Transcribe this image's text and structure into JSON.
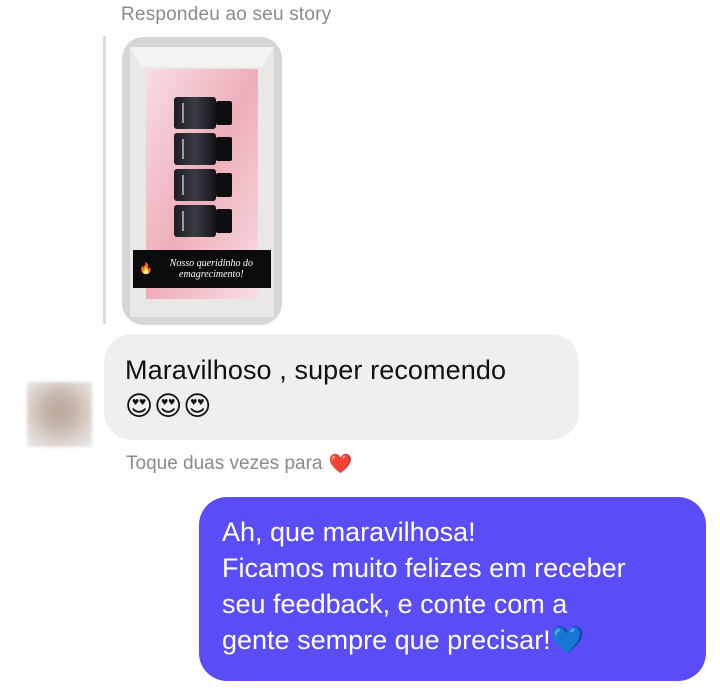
{
  "story_reply": {
    "label": "Respondeu ao seu story",
    "caption_icon": "fire-emoji",
    "caption": "Nosso queridinho do emagrecimento!"
  },
  "incoming_message": {
    "text": "Maravilhoso , super recomendo",
    "emojis": "😍😍😍"
  },
  "double_tap_hint": {
    "text": "Toque duas vezes para",
    "icon": "red-heart"
  },
  "outgoing_message": {
    "lines": [
      "Ah, que maravilhosa!",
      "Ficamos muito felizes em receber",
      "seu feedback, e conte com a",
      "gente sempre que precisar!💙"
    ]
  },
  "colors": {
    "outgoing_bubble": "#5a4cf7",
    "incoming_bubble": "#efefef",
    "meta_text": "#8a8a8a"
  }
}
